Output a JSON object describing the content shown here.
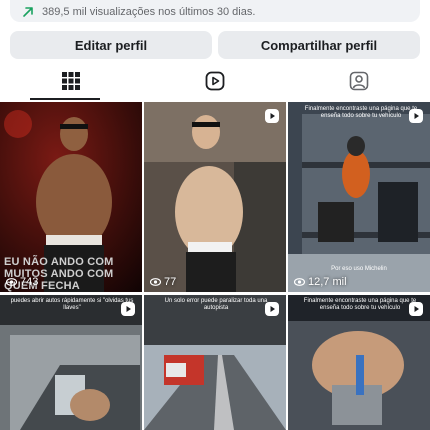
{
  "insights": {
    "text": "389,5 mil visualizações nos últimos 30 dias.",
    "accent": "#1aa260"
  },
  "actions": {
    "edit_label": "Editar perfil",
    "share_label": "Compartilhar perfil"
  },
  "tabs": [
    {
      "icon": "grid-icon",
      "active": true
    },
    {
      "icon": "reels-icon",
      "active": false
    },
    {
      "icon": "tagged-icon",
      "active": false
    }
  ],
  "posts": [
    {
      "views": "743",
      "is_reel": false,
      "caption": "EU NÃO ANDO COM MUITOS ANDO COM QUEM FECHA"
    },
    {
      "views": "77",
      "is_reel": true,
      "caption": ""
    },
    {
      "views": "12,7 mil",
      "is_reel": true,
      "caption": "Finalmente encontraste una página que te enseña todo sobre tu vehículo",
      "subcaption": "Por eso uso Michelin"
    },
    {
      "views": "",
      "is_reel": true,
      "caption": "puedes abrir autos rápidamente si \"olvidas tus llaves\""
    },
    {
      "views": "",
      "is_reel": true,
      "caption": "Un solo error puede paralizar toda una autopista"
    },
    {
      "views": "",
      "is_reel": true,
      "caption": "Finalmente encontraste una página que te enseña todo sobre tu vehículo"
    }
  ]
}
